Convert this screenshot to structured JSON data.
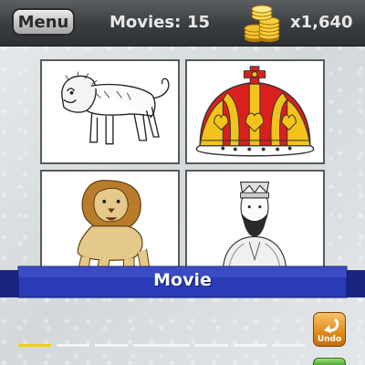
{
  "header": {
    "menu_label": "Menu",
    "movies_label": "Movies:",
    "movies_count": "15",
    "coins_value": "x1,640",
    "coins_icon": "gold-coins-icon"
  },
  "tiles": [
    {
      "depicts": "lion-walking-sketch"
    },
    {
      "depicts": "royal-crown"
    },
    {
      "depicts": "cartoon-lion"
    },
    {
      "depicts": "king-portrait-sketch"
    }
  ],
  "clue": {
    "label": "Movie"
  },
  "controls": {
    "undo_label": "Undo"
  },
  "answer": {
    "slots_total": 8,
    "slots_filled": 1
  },
  "colors": {
    "topbar": "#3a3d40",
    "ribbon": "#2a3bb8",
    "slot_active": "#f0d20a",
    "undo": "#e08a1a"
  }
}
